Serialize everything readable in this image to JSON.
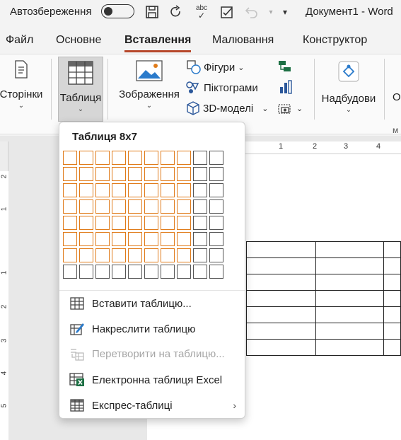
{
  "titlebar": {
    "autosave_label": "Автозбереження",
    "document_title": "Документ1 - Word",
    "icons": [
      "save-icon",
      "redo-icon",
      "spelling-icon",
      "checklist-icon",
      "undo-icon",
      "customize-icon"
    ],
    "spelling_icon_text": "abc"
  },
  "tabs": [
    {
      "label": "Файл"
    },
    {
      "label": "Основне"
    },
    {
      "label": "Вставлення",
      "active": true
    },
    {
      "label": "Малювання"
    },
    {
      "label": "Конструктор"
    }
  ],
  "ribbon": {
    "pages_label": "Сторінки",
    "table_label": "Таблиця",
    "images_label": "Зображення",
    "shapes_label": "Фігури",
    "icons_label": "Піктограми",
    "models_label": "3D-моделі",
    "addins_label": "Надбудови",
    "cut_label": "О",
    "cut_label2": "м"
  },
  "ruler": {
    "h_numbers": [
      "1",
      "2",
      "3",
      "4"
    ],
    "v_numbers": [
      "2",
      "1",
      "1",
      "2",
      "3",
      "4",
      "5"
    ]
  },
  "dropdown": {
    "title": "Таблиця 8x7",
    "grid": {
      "columns": 10,
      "rows": 8,
      "selected_columns": 8,
      "selected_rows": 7,
      "highlight_color": "#e07b1a"
    },
    "menu": [
      {
        "label": "Вставити таблицю...",
        "icon": "insert-table-icon",
        "enabled": true
      },
      {
        "label": "Накреслити таблицю",
        "icon": "draw-table-icon",
        "enabled": true
      },
      {
        "label": "Перетворити на таблицю...",
        "icon": "convert-table-icon",
        "enabled": false
      },
      {
        "label": "Електронна таблиця Excel",
        "icon": "excel-icon",
        "enabled": true
      },
      {
        "label": "Експрес-таблиці",
        "icon": "quick-tables-icon",
        "enabled": true,
        "submenu": true
      }
    ]
  },
  "colors": {
    "accent": "#b7472a",
    "excel_green": "#1d7044",
    "icon_blue": "#2b579a"
  }
}
